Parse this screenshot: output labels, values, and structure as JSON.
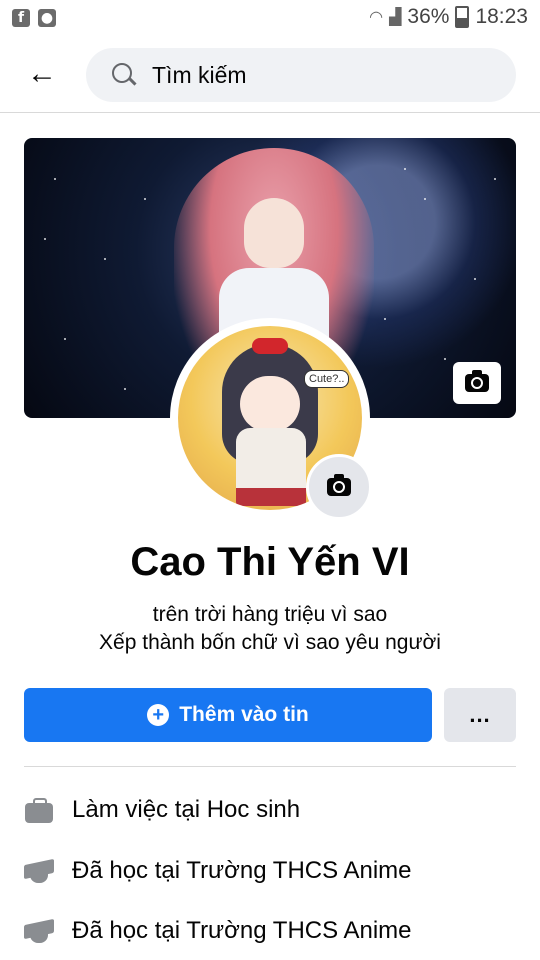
{
  "status_bar": {
    "battery": "36%",
    "time": "18:23"
  },
  "header": {
    "search_label": "Tìm kiếm"
  },
  "avatar": {
    "bubble_text": "Cute?.."
  },
  "profile": {
    "name": "Cao Thi Yến VI",
    "bio_line1": "trên trời hàng triệu vì sao",
    "bio_line2": "Xếp thành bốn chữ vì sao yêu người"
  },
  "actions": {
    "add_to_story": "Thêm vào tin",
    "more": "..."
  },
  "info": [
    {
      "icon": "briefcase-icon",
      "text": "Làm việc tại Hoc sinh"
    },
    {
      "icon": "graduation-cap-icon",
      "text": "Đã học tại Trường THCS Anime"
    },
    {
      "icon": "graduation-cap-icon",
      "text": "Đã học tại Trường THCS Anime"
    }
  ],
  "colors": {
    "primary": "#1877f2",
    "secondary_button": "#e4e6eb",
    "search_bg": "#f0f2f5"
  }
}
